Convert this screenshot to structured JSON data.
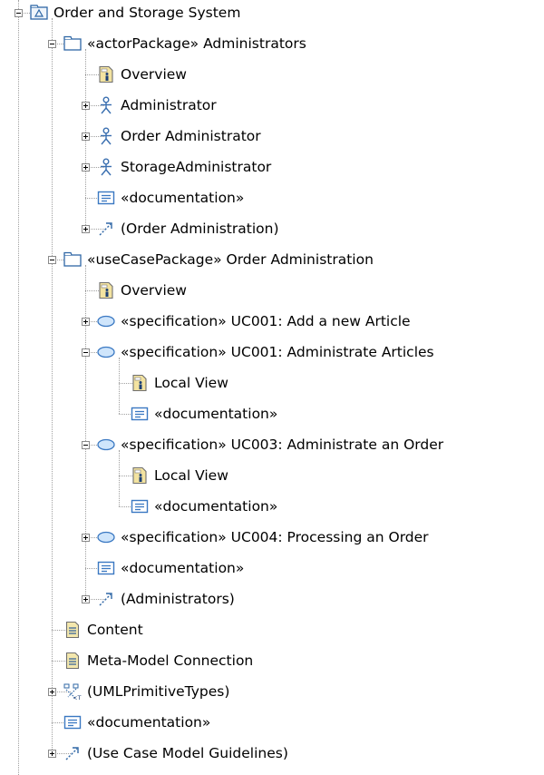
{
  "tree": {
    "nodes": [
      {
        "label": "Order and Storage System",
        "icon": "model-icon",
        "depth": 0,
        "toggle": "expanded"
      },
      {
        "label": "«actorPackage» Administrators",
        "icon": "package-icon",
        "depth": 1,
        "toggle": "expanded"
      },
      {
        "label": "Overview",
        "icon": "diagram-icon",
        "depth": 2,
        "toggle": "none"
      },
      {
        "label": "Administrator",
        "icon": "actor-icon",
        "depth": 2,
        "toggle": "collapsed"
      },
      {
        "label": "Order Administrator",
        "icon": "actor-icon",
        "depth": 2,
        "toggle": "collapsed"
      },
      {
        "label": "StorageAdministrator",
        "icon": "actor-icon",
        "depth": 2,
        "toggle": "collapsed"
      },
      {
        "label": "«documentation»",
        "icon": "documentation-icon",
        "depth": 2,
        "toggle": "none"
      },
      {
        "label": "(Order Administration)",
        "icon": "dependency-icon",
        "depth": 2,
        "toggle": "collapsed"
      },
      {
        "label": "«useCasePackage» Order Administration",
        "icon": "package-icon",
        "depth": 1,
        "toggle": "expanded"
      },
      {
        "label": "Overview",
        "icon": "diagram-icon",
        "depth": 2,
        "toggle": "none"
      },
      {
        "label": "«specification» UC001: Add a new Article",
        "icon": "usecase-icon",
        "depth": 2,
        "toggle": "collapsed"
      },
      {
        "label": "«specification» UC001: Administrate Articles",
        "icon": "usecase-icon",
        "depth": 2,
        "toggle": "expanded"
      },
      {
        "label": "Local View",
        "icon": "diagram-icon",
        "depth": 3,
        "toggle": "none"
      },
      {
        "label": "«documentation»",
        "icon": "documentation-icon",
        "depth": 3,
        "toggle": "none"
      },
      {
        "label": "«specification» UC003: Administrate an Order",
        "icon": "usecase-icon",
        "depth": 2,
        "toggle": "expanded"
      },
      {
        "label": "Local View",
        "icon": "diagram-icon",
        "depth": 3,
        "toggle": "none"
      },
      {
        "label": "«documentation»",
        "icon": "documentation-icon",
        "depth": 3,
        "toggle": "none"
      },
      {
        "label": "«specification» UC004: Processing an Order",
        "icon": "usecase-icon",
        "depth": 2,
        "toggle": "collapsed"
      },
      {
        "label": "«documentation»",
        "icon": "documentation-icon",
        "depth": 2,
        "toggle": "none"
      },
      {
        "label": "(Administrators)",
        "icon": "dependency-icon",
        "depth": 2,
        "toggle": "collapsed"
      },
      {
        "label": "Content",
        "icon": "content-icon",
        "depth": 1,
        "toggle": "none"
      },
      {
        "label": "Meta-Model Connection",
        "icon": "content-icon",
        "depth": 1,
        "toggle": "none"
      },
      {
        "label": "(UMLPrimitiveTypes)",
        "icon": "primitive-types-icon",
        "depth": 1,
        "toggle": "collapsed"
      },
      {
        "label": "«documentation»",
        "icon": "documentation-icon",
        "depth": 1,
        "toggle": "none"
      },
      {
        "label": "(Use Case Model Guidelines)",
        "icon": "dependency-icon",
        "depth": 1,
        "toggle": "collapsed"
      }
    ]
  },
  "colors": {
    "guide": "#a0a0a0",
    "package_stroke": "#2f67a6",
    "actor_stroke": "#3a6fb0",
    "usecase_fill": "#cfe5fb",
    "usecase_stroke": "#3a78c2",
    "doc_stroke": "#3a78c2",
    "diagram_fill": "#f3e3a0",
    "content_fill": "#f3e7ad"
  }
}
